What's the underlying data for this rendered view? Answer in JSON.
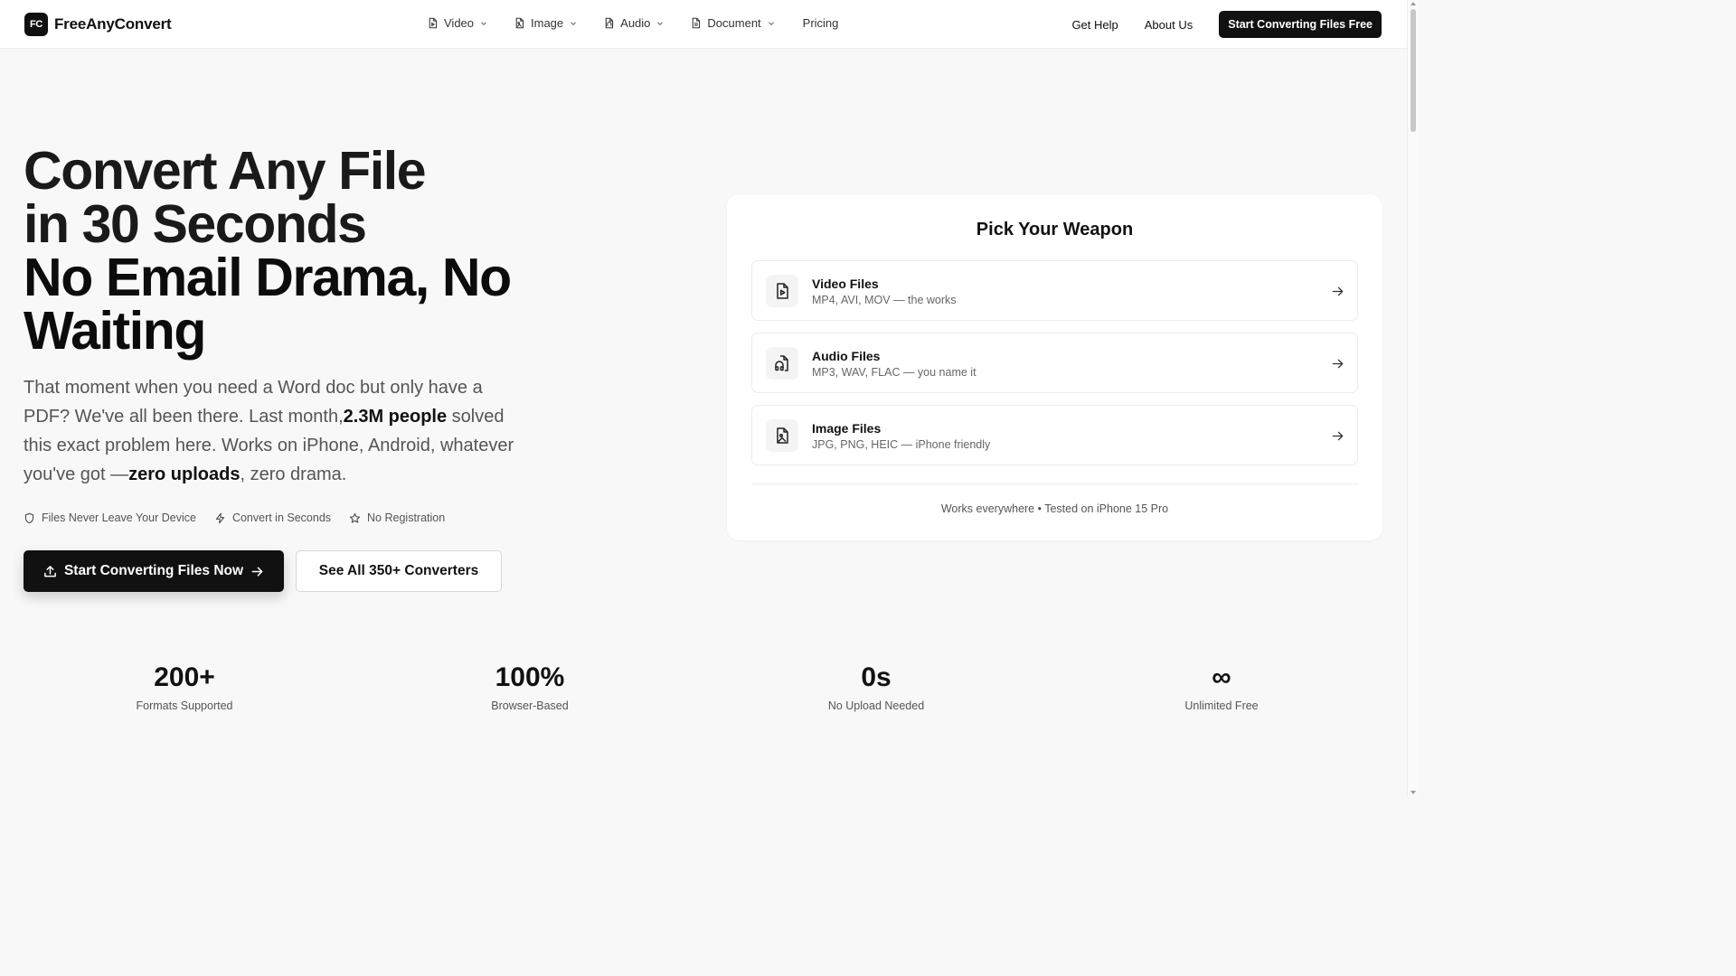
{
  "header": {
    "logo_mark": "FC",
    "brand": "FreeAnyConvert",
    "nav": [
      {
        "label": "Video",
        "icon": "file-video-icon"
      },
      {
        "label": "Image",
        "icon": "file-image-icon"
      },
      {
        "label": "Audio",
        "icon": "file-audio-icon"
      },
      {
        "label": "Document",
        "icon": "file-text-icon"
      }
    ],
    "pricing": "Pricing",
    "get_help": "Get Help",
    "about": "About Us",
    "cta": "Start Converting Files Free"
  },
  "hero": {
    "title_lines": [
      "Convert Any File",
      "in 30 Seconds",
      "No Email Drama, No",
      "Waiting"
    ],
    "sub_part1": "That moment when you need a Word doc but only have a PDF? We've all been there. Last month,",
    "sub_bold1": "2.3M people",
    "sub_part2": " solved this exact problem here. Works on iPhone, Android, whatever you've got —",
    "sub_bold2": "zero uploads",
    "sub_part3": ", zero drama.",
    "features": [
      {
        "label": "Files Never Leave Your Device",
        "icon": "shield-icon"
      },
      {
        "label": "Convert in Seconds",
        "icon": "lightning-icon"
      },
      {
        "label": "No Registration",
        "icon": "star-icon"
      }
    ],
    "primary_button": "Start Converting Files Now",
    "secondary_button": "See All 350+ Converters"
  },
  "card": {
    "title": "Pick Your Weapon",
    "options": [
      {
        "name": "Video Files",
        "desc": "MP4, AVI, MOV — the works",
        "icon": "file-video-icon"
      },
      {
        "name": "Audio Files",
        "desc": "MP3, WAV, FLAC — you name it",
        "icon": "file-audio-icon"
      },
      {
        "name": "Image Files",
        "desc": "JPG, PNG, HEIC — iPhone friendly",
        "icon": "file-image-icon"
      }
    ],
    "footer": "Works everywhere • Tested on iPhone 15 Pro"
  },
  "stats": [
    {
      "value": "200+",
      "label": "Formats Supported"
    },
    {
      "value": "100%",
      "label": "Browser-Based"
    },
    {
      "value": "0s",
      "label": "No Upload Needed"
    },
    {
      "value": "∞",
      "label": "Unlimited Free"
    }
  ],
  "colors": {
    "primary": "#111111",
    "background": "#f8f8f9",
    "card": "#ffffff",
    "muted_text": "#555555"
  }
}
